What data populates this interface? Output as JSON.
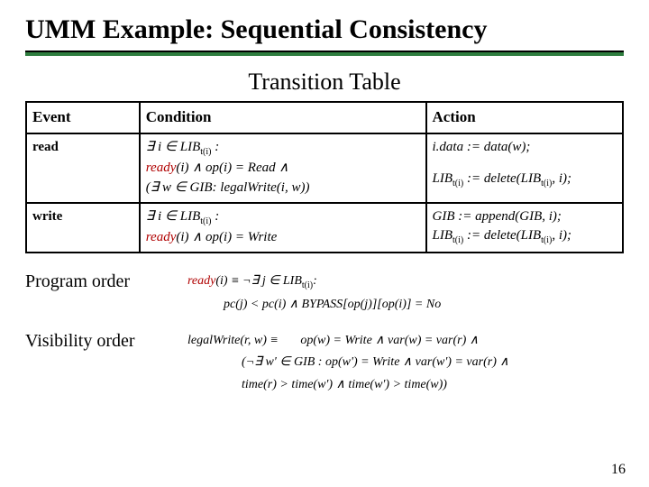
{
  "title": "UMM Example: Sequential Consistency",
  "subtitle": "Transition Table",
  "headers": {
    "event": "Event",
    "condition": "Condition",
    "action": "Action"
  },
  "rows": {
    "read": {
      "event": "read",
      "cond1a": "∃ i ∈ LIB",
      "cond1b": " :",
      "cond2_ready": "ready",
      "cond2_rest": "(i) ∧ op(i) = Read ∧",
      "cond3": "(∃ w ∈ GIB: legalWrite(i, w))",
      "act1": "i.data := data(w);",
      "act2a": "LIB",
      "act2b": " := delete(LIB",
      "act2c": ", i);"
    },
    "write": {
      "event": "write",
      "cond1a": "∃ i ∈ LIB",
      "cond1b": " :",
      "cond2_ready": "ready",
      "cond2_rest": "(i) ∧ op(i) = Write",
      "act1": "GIB := append(GIB, i);",
      "act2a": "LIB",
      "act2b": " := delete(LIB",
      "act2c": ", i);"
    }
  },
  "subscripts": {
    "tid": "t(i)"
  },
  "defs": {
    "program_order": {
      "label": "Program order",
      "line1_ready": "ready",
      "line1_rest": "(i) ≡ ¬∃ j ∈ LIB",
      "line1_tail": ":",
      "line2": "pc(j) < pc(i) ∧ BYPASS[op(j)][op(i)] = No"
    },
    "visibility_order": {
      "label": "Visibility order",
      "line1_lhs": "legalWrite(r, w) ≡",
      "line1_rhs": "op(w) = Write ∧ var(w) = var(r) ∧",
      "line2": "(¬∃ w' ∈ GIB : op(w') = Write ∧ var(w') = var(r) ∧",
      "line3": "time(r) > time(w') ∧ time(w') > time(w))"
    }
  },
  "page_number": "16"
}
